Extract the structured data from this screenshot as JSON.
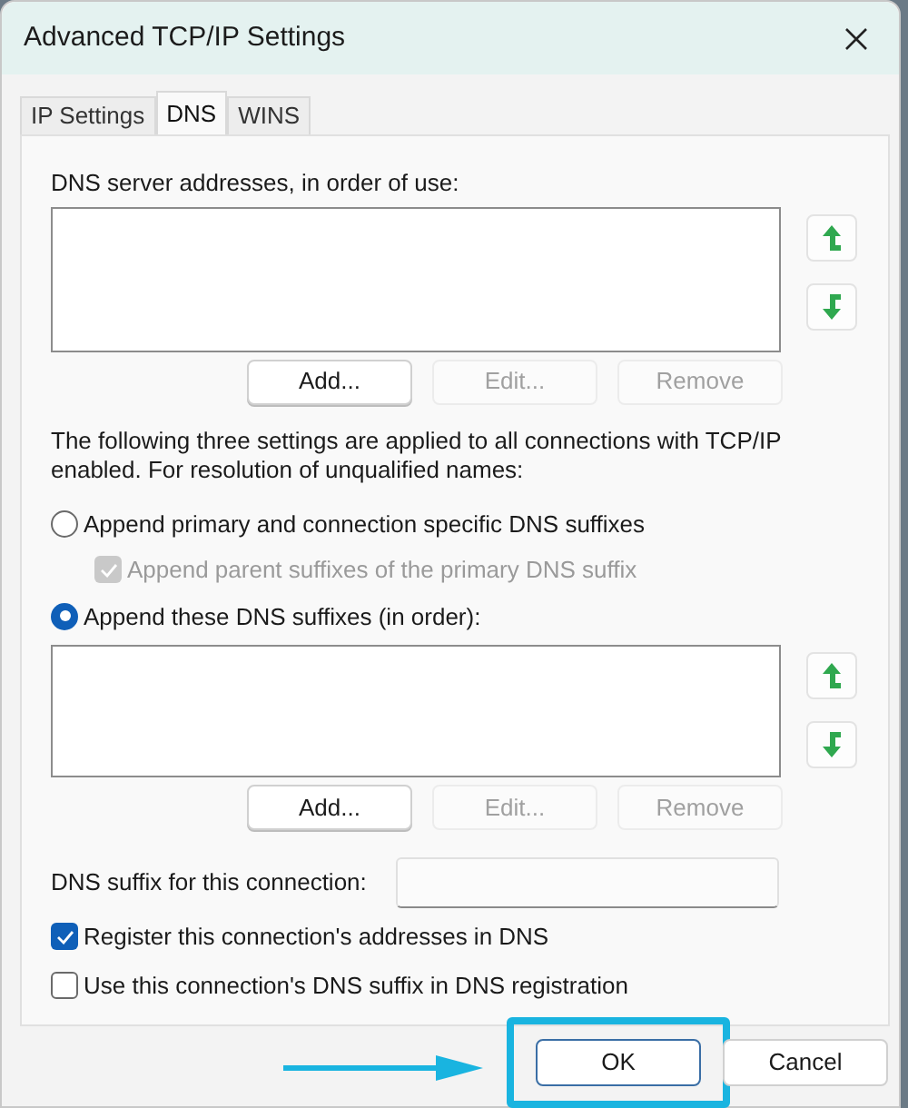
{
  "window": {
    "title": "Advanced TCP/IP Settings"
  },
  "tabs": [
    {
      "label": "IP Settings",
      "selected": false
    },
    {
      "label": "DNS",
      "selected": true
    },
    {
      "label": "WINS",
      "selected": false
    }
  ],
  "dns_servers": {
    "label": "DNS server addresses, in order of use:",
    "buttons": [
      {
        "label": "Add...",
        "disabled": false
      },
      {
        "label": "Edit...",
        "disabled": true
      },
      {
        "label": "Remove",
        "disabled": true
      }
    ]
  },
  "description": "The following three settings are applied to all connections with TCP/IP enabled. For resolution of unqualified names:",
  "options": [
    {
      "kind": "radio",
      "label": "Append primary and connection specific DNS suffixes",
      "selected": false
    },
    {
      "kind": "checkbox",
      "label": "Append parent suffixes of the primary DNS suffix",
      "checked": true,
      "disabled": true
    },
    {
      "kind": "radio",
      "label": "Append these DNS suffixes (in order):",
      "selected": true
    }
  ],
  "dns_suffixes": {
    "buttons": [
      {
        "label": "Add...",
        "disabled": false
      },
      {
        "label": "Edit...",
        "disabled": true
      },
      {
        "label": "Remove",
        "disabled": true
      }
    ]
  },
  "suffix_field": {
    "label": "DNS suffix for this connection:"
  },
  "checkboxes": [
    {
      "label": "Register this connection's addresses in DNS",
      "checked": true
    },
    {
      "label": "Use this connection's DNS suffix in DNS registration",
      "checked": false
    }
  ],
  "footer_buttons": [
    {
      "label": "OK",
      "highlighted": true
    },
    {
      "label": "Cancel",
      "highlighted": false
    }
  ]
}
